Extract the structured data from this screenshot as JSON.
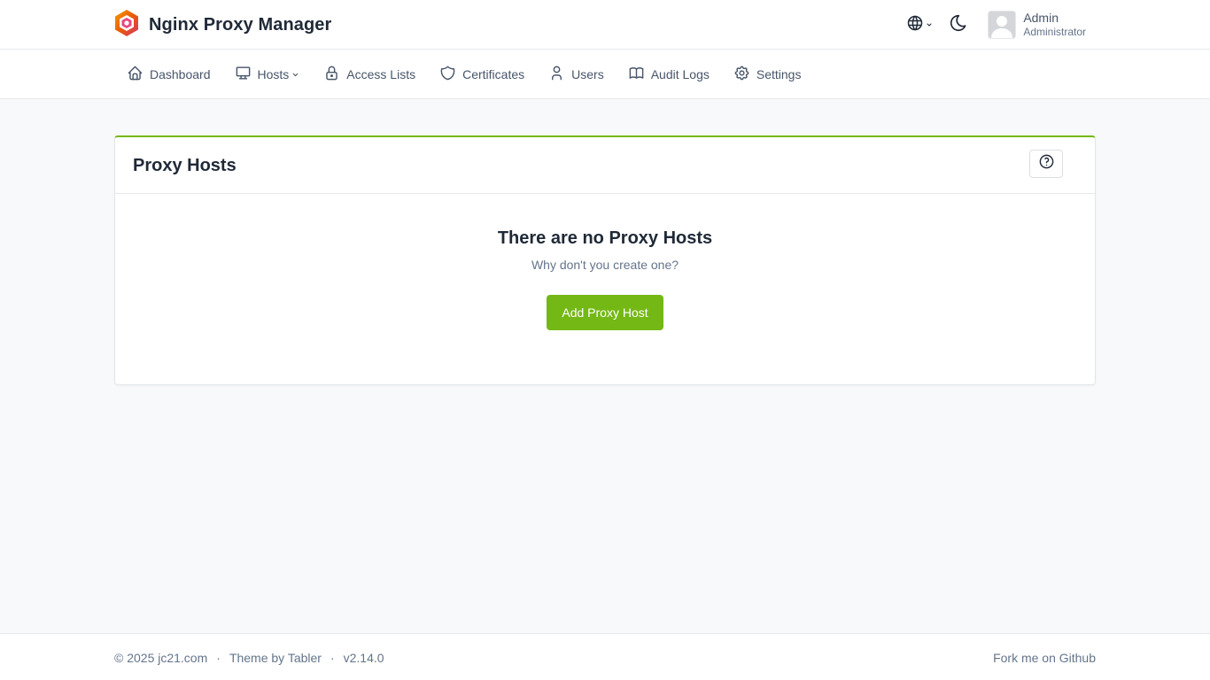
{
  "app": {
    "title": "Nginx Proxy Manager",
    "logo_icon": "npm-hexagon-logo"
  },
  "header": {
    "language_icon": "globe-icon",
    "theme_icon": "moon-icon",
    "user": {
      "name": "Admin",
      "role": "Administrator"
    }
  },
  "nav": {
    "items": [
      {
        "label": "Dashboard",
        "icon": "home-icon"
      },
      {
        "label": "Hosts",
        "icon": "monitor-icon",
        "has_dropdown": true
      },
      {
        "label": "Access Lists",
        "icon": "lock-icon"
      },
      {
        "label": "Certificates",
        "icon": "shield-icon"
      },
      {
        "label": "Users",
        "icon": "user-icon"
      },
      {
        "label": "Audit Logs",
        "icon": "book-icon"
      },
      {
        "label": "Settings",
        "icon": "gear-icon"
      }
    ]
  },
  "card": {
    "title": "Proxy Hosts",
    "help_icon": "help-circle-icon",
    "empty_title": "There are no Proxy Hosts",
    "empty_subtitle": "Why don't you create one?",
    "add_button_label": "Add Proxy Host"
  },
  "footer": {
    "copyright": "© 2025 jc21.com",
    "sep1": "·",
    "theme_credit": "Theme by Tabler",
    "sep2": "·",
    "version": "v2.14.0",
    "github_link": "Fork me on Github"
  },
  "colors": {
    "accent": "#74b816",
    "background": "#f8f9fb",
    "text": "#1f2937",
    "muted": "#64748b"
  }
}
